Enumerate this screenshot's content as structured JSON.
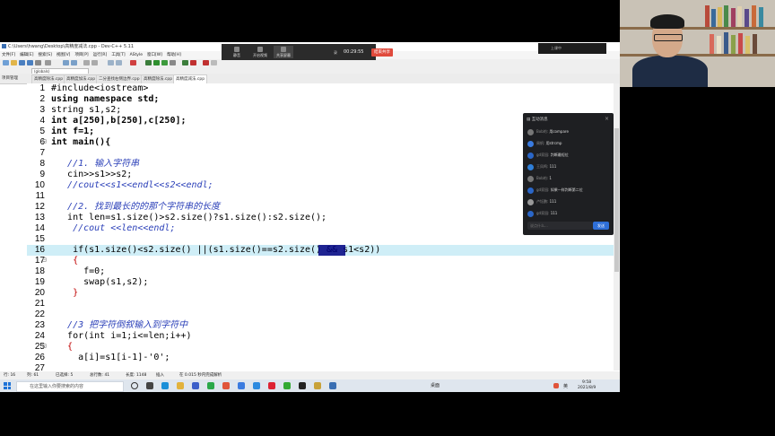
{
  "window": {
    "title": "C:\\Users\\hwang\\Desktop\\高精度减法.cpp - Dev-C++ 5.11"
  },
  "menu": [
    "文件[F]",
    "编辑[E]",
    "搜索[S]",
    "视图[V]",
    "项目[P]",
    "运行[R]",
    "工具[T]",
    "AStyle",
    "窗口[W]",
    "帮助[H]"
  ],
  "toolbar": {
    "compiler_combo": "(globals)"
  },
  "project_panel": {
    "label": "项目管理"
  },
  "tabs": [
    "高精度除法.cpp",
    "高精度加法.cpp",
    "二分查找右侧边界.cpp",
    "高精度除法.cpp",
    "高精度减法.cpp"
  ],
  "active_tab": 4,
  "code_lines": [
    {
      "n": "1",
      "text": "#include<iostream>"
    },
    {
      "n": "2",
      "text": "using namespace std;"
    },
    {
      "n": "3",
      "text": "string s1,s2;"
    },
    {
      "n": "4",
      "text": "int a[250],b[250],c[250];"
    },
    {
      "n": "5",
      "text": "int f=1;"
    },
    {
      "n": "6",
      "text": "int main(){"
    },
    {
      "n": "7",
      "text": ""
    },
    {
      "n": "8",
      "text": "   //1. 输入字符串"
    },
    {
      "n": "9",
      "text": "   cin>>s1>>s2;"
    },
    {
      "n": "10",
      "text": "   //cout<<s1<<endl<<s2<<endl;"
    },
    {
      "n": "11",
      "text": ""
    },
    {
      "n": "12",
      "text": "   //2. 找到最长的的那个字符串的长度"
    },
    {
      "n": "13",
      "text": "   int len=s1.size()>s2.size()?s1.size():s2.size();"
    },
    {
      "n": "14",
      "text": "    //cout <<len<<endl;"
    },
    {
      "n": "15",
      "text": ""
    },
    {
      "n": "16",
      "text": "    if(s1.size()<s2.size() ||(s1.size()==s2.size() && s1<s2))"
    },
    {
      "n": "17",
      "text": "    {"
    },
    {
      "n": "18",
      "text": "      f=0;"
    },
    {
      "n": "19",
      "text": "      swap(s1,s2);"
    },
    {
      "n": "20",
      "text": "    }"
    },
    {
      "n": "21",
      "text": ""
    },
    {
      "n": "22",
      "text": ""
    },
    {
      "n": "23",
      "text": "   //3 把字符倒叙输入到字符中"
    },
    {
      "n": "24",
      "text": "   for(int i=1;i<=len;i++)"
    },
    {
      "n": "25",
      "text": "   {"
    },
    {
      "n": "26",
      "text": "     a[i]=s1[i-1]-'0';"
    },
    {
      "n": "27",
      "text": ""
    }
  ],
  "highlighted_line": "16",
  "status": {
    "row": "行: 16",
    "col": "列: 61",
    "selected": "已选择: 5",
    "total_lines": "总行数: 41",
    "length": "长度: 1148",
    "insert": "插入",
    "parse": "在 0.015 秒内完成解析"
  },
  "taskbar": {
    "search_placeholder": "在这里输入你要搜索的内容",
    "time": "9:58",
    "date": "2021/8/9",
    "lang": "英"
  },
  "meeting_bar": {
    "buttons": [
      "静音",
      "开启视频",
      "共享屏幕"
    ],
    "rec_label": "录",
    "time": "00:29:55",
    "end_label": "结束共享"
  },
  "top_right_bar": {
    "label": "上课中"
  },
  "chat": {
    "title": "互动消息",
    "messages": [
      {
        "name": "Bob的",
        "text": "用compare"
      },
      {
        "name": "周帆",
        "text": "用strcmp"
      },
      {
        "name": "gd家园",
        "text": "判断最短位"
      },
      {
        "name": "王凤鸣",
        "text": "111"
      },
      {
        "name": "Bob的",
        "text": "1"
      },
      {
        "name": "gd家园",
        "text": "如果一样判断第二位"
      },
      {
        "name": "卢钰鹏",
        "text": "111"
      },
      {
        "name": "gd家园",
        "text": "111"
      }
    ],
    "input_placeholder": "说点什么...",
    "send_label": "发送"
  },
  "colors": {
    "code_highlight": "#cfeef7",
    "selection": "#000080",
    "comment": "#2a3fb8",
    "number": "#c00000",
    "end_button": "#e04a3c",
    "send_button": "#2e6fd8"
  }
}
